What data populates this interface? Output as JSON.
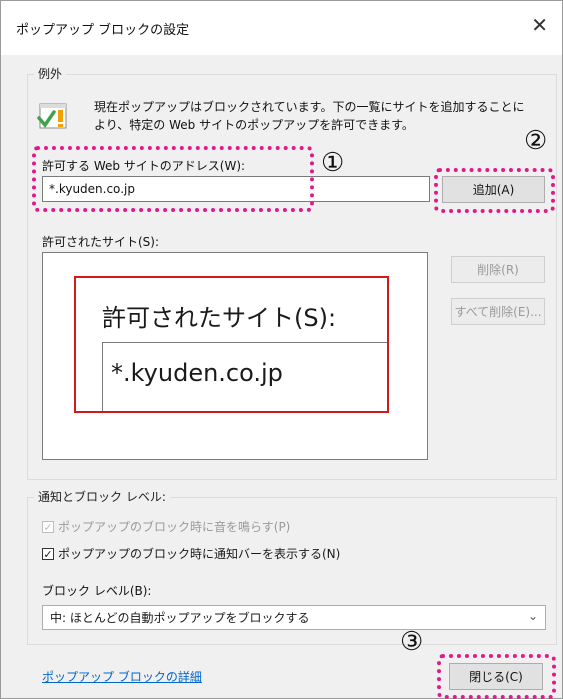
{
  "window": {
    "title": "ポップアップ ブロックの設定",
    "close_glyph": "✕"
  },
  "exceptions": {
    "group_title": "例外",
    "description": "現在ポップアップはブロックされています。下の一覧にサイトを追加することにより、特定の Web サイトのポップアップを許可できます。",
    "address_label": "許可する Web サイトのアドレス(W):",
    "address_value": "*.kyuden.co.jp",
    "add_button": "追加(A)",
    "allowed_label": "許可されたサイト(S):",
    "remove_button": "削除(R)",
    "remove_all_button": "すべて削除(E)...",
    "zoom_label": "許可されたサイト(S):",
    "zoom_value": "*.kyuden.co.jp"
  },
  "notification": {
    "group_title": "通知とブロック レベル:",
    "play_sound": {
      "label": "ポップアップのブロック時に音を鳴らす(P)",
      "checked": true,
      "enabled": false
    },
    "show_bar": {
      "label": "ポップアップのブロック時に通知バーを表示する(N)",
      "checked": true,
      "enabled": true
    },
    "block_level_label": "ブロック レベル(B):",
    "block_level_value": "中: ほとんどの自動ポップアップをブロックする"
  },
  "footer": {
    "learn_more_link": "ポップアップ ブロックの詳細",
    "close_button": "閉じる(C)"
  },
  "markers": {
    "one": "①",
    "two": "②",
    "three": "③"
  },
  "colors": {
    "highlight": "#e01a8a",
    "zoom_border": "#d11a1a",
    "link": "#0066cc"
  }
}
